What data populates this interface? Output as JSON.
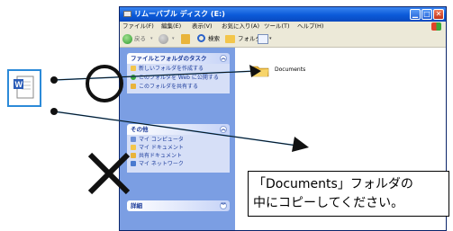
{
  "window": {
    "title": "リムーバブル ディスク (E:)",
    "menus": [
      "ファイル(F)",
      "編集(E)",
      "表示(V)",
      "お気に入り(A)",
      "ツール(T)",
      "ヘルプ(H)"
    ],
    "toolbar": {
      "back": "戻る",
      "search": "検索",
      "folders": "フォルダ"
    }
  },
  "taskpane": {
    "file_tasks_title": "ファイルとフォルダのタスク",
    "file_tasks": [
      "新しいフォルダを作成する",
      "このフォルダを Web に公開する",
      "このフォルダを共有する"
    ],
    "other_title": "その他",
    "other_places": [
      "マイ コンピュータ",
      "マイ ドキュメント",
      "共有ドキュメント",
      "マイ ネットワーク"
    ],
    "details_title": "詳細"
  },
  "content": {
    "folder_name": "Documents"
  },
  "callout": {
    "text": "「Documents」フォルダの\n中にコピーしてください。"
  },
  "colors": {
    "accent_blue": "#2c8ad8",
    "pane_blue": "#7b9ee3",
    "title_blue": "#0b5ad9"
  }
}
